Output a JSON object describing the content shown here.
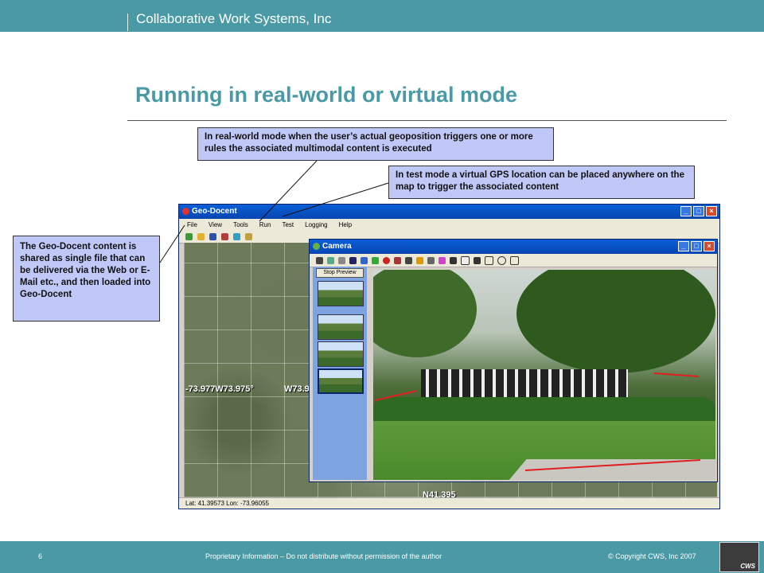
{
  "header": {
    "company": "Collaborative Work Systems, Inc"
  },
  "slide": {
    "title": "Running in real-world or virtual mode"
  },
  "callouts": {
    "realworld": "In real-world mode when the user’s actual geoposition triggers one or more rules the associated multimodal content is executed",
    "testmode": "In test mode a virtual GPS location can be placed anywhere on the map to trigger the associated content",
    "sharing": "The Geo-Docent content is shared as single file that can be delivered via the Web or E-Mail etc., and then loaded into Geo-Docent"
  },
  "geo_window": {
    "title": "Geo-Docent",
    "menu": [
      "File",
      "View",
      "Tools",
      "Run",
      "Test",
      "Logging",
      "Help"
    ],
    "coord_labels": [
      "-73.977W73.975°",
      "W73.9"
    ],
    "bottom_label": "N41.395",
    "status": "Lat: 41.39573   Lon: -73.96055"
  },
  "camera_window": {
    "title": "Camera",
    "stop_button": "Stop Preview"
  },
  "footer": {
    "page_number": "6",
    "proprietary": "Proprietary Information – Do not distribute without permission of the author",
    "copyright": "© Copyright CWS, Inc 2007",
    "logo_text": "CWS"
  },
  "colors": {
    "teal": "#4a9aa5",
    "callout_fill": "#c0c8f8",
    "title_bar": "#0a5fd8"
  }
}
